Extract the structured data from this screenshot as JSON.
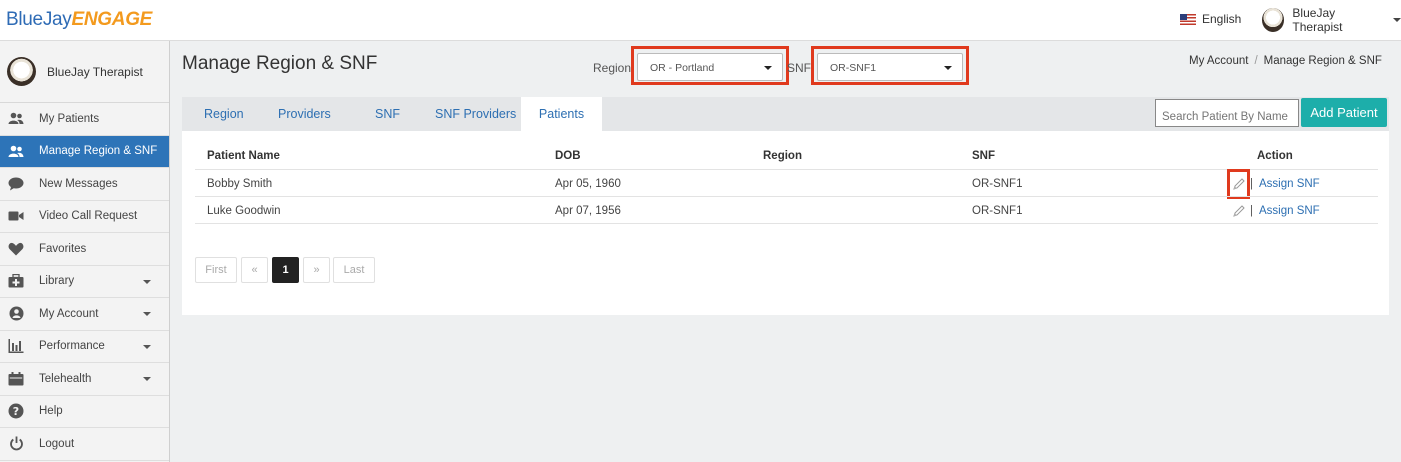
{
  "logo": {
    "part1": "BlueJay",
    "part2": "ENGAGE"
  },
  "topbar": {
    "language": "English",
    "user_name": "BlueJay Therapist"
  },
  "sidebar": {
    "user_name": "BlueJay Therapist",
    "items": [
      {
        "label": "My Patients",
        "icon": "patients-icon",
        "active": false,
        "dropdown": false
      },
      {
        "label": "Manage Region & SNF",
        "icon": "patients-icon",
        "active": true,
        "dropdown": false
      },
      {
        "label": "New Messages",
        "icon": "chat-icon",
        "active": false,
        "dropdown": false
      },
      {
        "label": "Video Call Request",
        "icon": "video-icon",
        "active": false,
        "dropdown": false
      },
      {
        "label": "Favorites",
        "icon": "heart-icon",
        "active": false,
        "dropdown": false
      },
      {
        "label": "Library",
        "icon": "medkit-icon",
        "active": false,
        "dropdown": true
      },
      {
        "label": "My Account",
        "icon": "user-circle-icon",
        "active": false,
        "dropdown": true
      },
      {
        "label": "Performance",
        "icon": "bar-chart-icon",
        "active": false,
        "dropdown": true
      },
      {
        "label": "Telehealth",
        "icon": "calendar-icon",
        "active": false,
        "dropdown": true
      },
      {
        "label": "Help",
        "icon": "help-icon",
        "active": false,
        "dropdown": false
      },
      {
        "label": "Logout",
        "icon": "power-icon",
        "active": false,
        "dropdown": false
      }
    ]
  },
  "page": {
    "title": "Manage Region & SNF"
  },
  "filters": {
    "region_label": "Region:",
    "region_value": "OR - Portland",
    "snf_label": "SNF:",
    "snf_value": "OR-SNF1"
  },
  "breadcrumb": {
    "parent": "My Account",
    "separator": "/",
    "current": "Manage Region & SNF"
  },
  "tabs": [
    {
      "label": "Region",
      "active": false
    },
    {
      "label": "Providers",
      "active": false
    },
    {
      "label": "SNF",
      "active": false
    },
    {
      "label": "SNF Providers",
      "active": false
    },
    {
      "label": "Patients",
      "active": true
    }
  ],
  "search": {
    "placeholder": "Search Patient By Name"
  },
  "add_button": {
    "label": "Add Patient"
  },
  "table": {
    "headers": [
      "Patient Name",
      "DOB",
      "Region",
      "SNF",
      "Action"
    ],
    "rows": [
      {
        "name": "Bobby Smith",
        "dob": "Apr 05, 1960",
        "region": "",
        "snf": "OR-SNF1",
        "action_link": "Assign SNF",
        "separator": "|"
      },
      {
        "name": "Luke Goodwin",
        "dob": "Apr 07, 1956",
        "region": "",
        "snf": "OR-SNF1",
        "action_link": "Assign SNF",
        "separator": "|"
      }
    ]
  },
  "pagination": {
    "first": "First",
    "prev": "«",
    "current": "1",
    "next": "»",
    "last": "Last"
  },
  "colors": {
    "brand_blue": "#2d74b8",
    "teal": "#1daeaa",
    "highlight_red": "#e03a1e",
    "logo_orange": "#f39a1e"
  }
}
